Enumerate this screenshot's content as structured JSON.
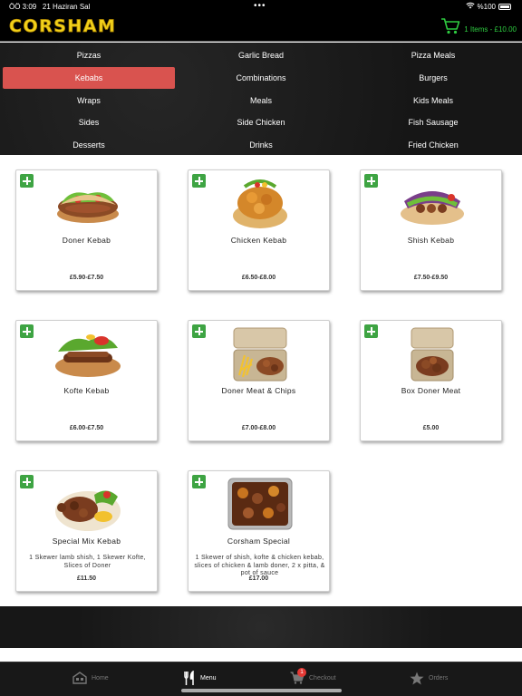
{
  "status_bar": {
    "time": "ÖÖ 3:09",
    "date": "21 Haziran Sal",
    "dots": "•••",
    "battery": "%100"
  },
  "header": {
    "logo": "CORSHAM",
    "cart_summary": "1 Items - £10.00"
  },
  "categories": [
    {
      "label": "Pizzas",
      "active": false
    },
    {
      "label": "Garlic Bread",
      "active": false
    },
    {
      "label": "Pizza Meals",
      "active": false
    },
    {
      "label": "Kebabs",
      "active": true
    },
    {
      "label": "Combinations",
      "active": false
    },
    {
      "label": "Burgers",
      "active": false
    },
    {
      "label": "Wraps",
      "active": false
    },
    {
      "label": "Meals",
      "active": false
    },
    {
      "label": "Kids Meals",
      "active": false
    },
    {
      "label": "Sides",
      "active": false
    },
    {
      "label": "Side Chicken",
      "active": false
    },
    {
      "label": "Fish Sausage",
      "active": false
    },
    {
      "label": "Desserts",
      "active": false
    },
    {
      "label": "Drinks",
      "active": false
    },
    {
      "label": "Fried Chicken",
      "active": false
    }
  ],
  "products": [
    {
      "name": "Doner Kebab",
      "description": "",
      "price": "£5.90-£7.50",
      "image": "doner-kebab"
    },
    {
      "name": "Chicken Kebab",
      "description": "",
      "price": "£6.50-£8.00",
      "image": "chicken-kebab"
    },
    {
      "name": "Shish Kebab",
      "description": "",
      "price": "£7.50-£9.50",
      "image": "shish-kebab"
    },
    {
      "name": "Kofte Kebab",
      "description": "",
      "price": "£6.00-£7.50",
      "image": "kofte-kebab"
    },
    {
      "name": "Doner Meat & Chips",
      "description": "",
      "price": "£7.00-£8.00",
      "image": "doner-meat-chips"
    },
    {
      "name": "Box Doner Meat",
      "description": "",
      "price": "£5.00",
      "image": "box-doner-meat"
    },
    {
      "name": "Special Mix Kebab",
      "description": "1 Skewer lamb shish, 1 Skewer Kofte, Slices of Doner",
      "price": "£11.50",
      "image": "special-mix-kebab"
    },
    {
      "name": "Corsham Special",
      "description": "1 Skewer of shish, kofte & chicken kebab, slices of chicken & lamb doner, 2 x pitta, & pot of sauce",
      "price": "£17.00",
      "image": "corsham-special"
    }
  ],
  "tabbar": {
    "home": "Home",
    "menu": "Menu",
    "checkout": "Checkout",
    "checkout_badge": "1",
    "orders": "Orders"
  },
  "colors": {
    "accent_active": "#d9534f",
    "cart_green": "#2ecc40",
    "add_green": "#3ea443",
    "logo_yellow": "#f2d21b"
  }
}
